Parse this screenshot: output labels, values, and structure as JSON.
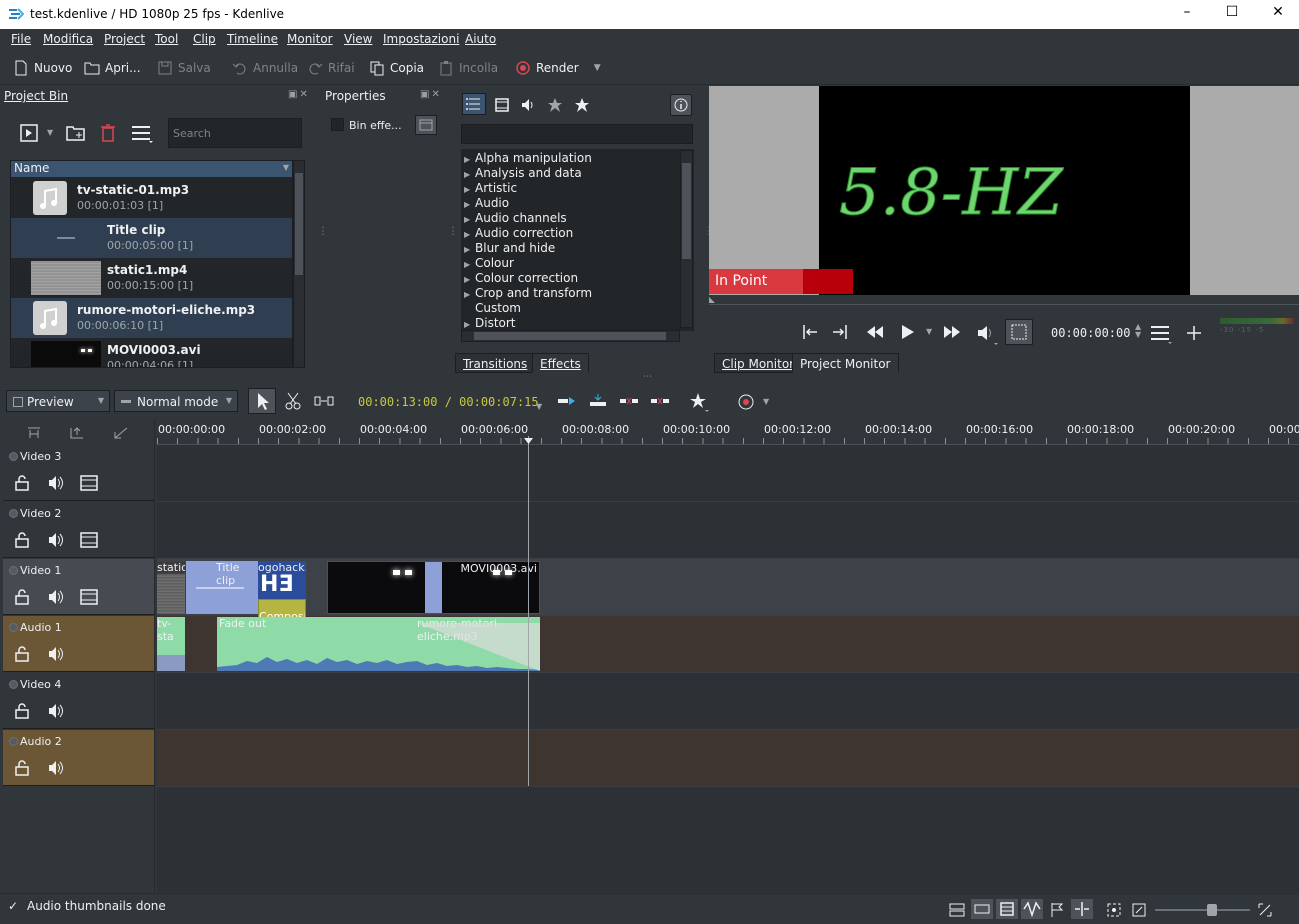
{
  "window": {
    "title": "test.kdenlive / HD 1080p 25 fps - Kdenlive"
  },
  "menu": [
    "File",
    "Modifica",
    "Project",
    "Tool",
    "Clip",
    "Timeline",
    "Monitor",
    "View",
    "Impostazioni",
    "Aiuto"
  ],
  "toolbar": {
    "new": "Nuovo",
    "open": "Apri...",
    "save": "Salva",
    "undo": "Annulla",
    "redo": "Rifai",
    "copy": "Copia",
    "paste": "Incolla",
    "render": "Render"
  },
  "project_bin": {
    "title": "Project Bin",
    "search_placeholder": "Search",
    "column": "Name",
    "items": [
      {
        "name": "tv-static-01.mp3",
        "meta": "00:00:01:03  [1]",
        "kind": "audio"
      },
      {
        "name": "Title clip",
        "meta": "00:00:05:00  [1]",
        "kind": "title"
      },
      {
        "name": "static1.mp4",
        "meta": "00:00:15:00  [1]",
        "kind": "static"
      },
      {
        "name": "rumore-motori-eliche.mp3",
        "meta": "00:00:06:10  [1]",
        "kind": "audio"
      },
      {
        "name": "MOVI0003.avi",
        "meta": "00:00:04:06  [1]",
        "kind": "video"
      }
    ]
  },
  "properties": {
    "title": "Properties",
    "bin_effects": "Bin effe..."
  },
  "effects": {
    "categories": [
      "Alpha manipulation",
      "Analysis and data",
      "Artistic",
      "Audio",
      "Audio channels",
      "Audio correction",
      "Blur and hide",
      "Colour",
      "Colour correction",
      "Crop and transform",
      "Custom",
      "Distort"
    ],
    "tab_transitions": "Transitions",
    "tab_effects": "Effects"
  },
  "monitor": {
    "overlay_text": "5.8-HZ",
    "in_point_label": "In Point",
    "timecode": "00:00:00:00",
    "tab_clip": "Clip Monitor",
    "tab_project": "Project Monitor"
  },
  "timeline_toolbar": {
    "preview": "Preview",
    "mode": "Normal mode",
    "timecode": "00:00:13:00 / 00:00:07:15"
  },
  "ruler": [
    "00:00:00:00",
    "00:00:02:00",
    "00:00:04:00",
    "00:00:06:00",
    "00:00:08:00",
    "00:00:10:00",
    "00:00:12:00",
    "00:00:14:00",
    "00:00:16:00",
    "00:00:18:00",
    "00:00:20:00",
    "00:00"
  ],
  "tracks": [
    {
      "name": "Video 3",
      "type": "video"
    },
    {
      "name": "Video 2",
      "type": "video"
    },
    {
      "name": "Video 1",
      "type": "video"
    },
    {
      "name": "Audio 1",
      "type": "audio"
    },
    {
      "name": "Video 4",
      "type": "audio-plain"
    },
    {
      "name": "Audio 2",
      "type": "audio"
    }
  ],
  "clips": {
    "static": "static:",
    "title": "Title clip",
    "pogohack": "ogohack.p",
    "movi": "MOVI0003.avi",
    "composite": "Composite",
    "tvsta": "tv-sta",
    "fadeout": "Fade out",
    "rumore": "rumore-motori-eliche.mp3"
  },
  "status": {
    "message": "Audio thumbnails done"
  }
}
